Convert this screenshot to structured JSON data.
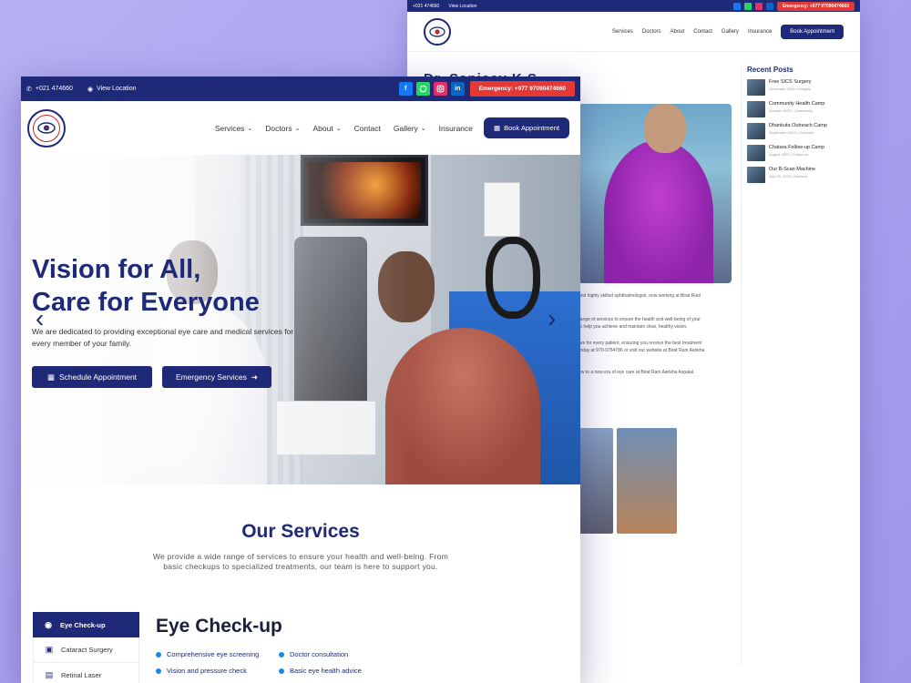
{
  "back": {
    "topbar": {
      "phone": "+021 474660",
      "location": "View Location",
      "emergency": "Emergency: +977 97090474660"
    },
    "nav": [
      "Services",
      "Doctors",
      "About",
      "Contact",
      "Gallery",
      "Insurance"
    ],
    "book": "Book Appointment",
    "title": "Dr. Sanjeev K.S.",
    "paragraphs": [
      "and highly skilled ophthalmologist, now working at Birat Rani",
      "range of services to ensure the health and well-being of your",
      "to help you achieve and maintain clear, healthy vision.",
      "are for every patient, ensuring you receive the best treatment",
      "today at 970-9754786 or visit our website at Birat Rani Aankha",
      "ew to a new era of eye care at Birat Rani Aankha Aspatal."
    ],
    "recent_posts_title": "Recent Posts",
    "posts": [
      {
        "title": "Free SICS Surgery",
        "meta": "December 2023 • Surgery"
      },
      {
        "title": "Community Health Camp",
        "meta": "October 2023 • Community"
      },
      {
        "title": "Dhankuta Outreach Camp",
        "meta": "September 2023 • Outreach"
      },
      {
        "title": "Chatara Follow-up Camp",
        "meta": "August 2023 • Follow-up"
      },
      {
        "title": "Our B-Scan Machine",
        "meta": "July 25, 2023 • Machine"
      }
    ]
  },
  "front": {
    "topbar": {
      "phone": "+021 474660",
      "location": "View Location",
      "socials": [
        "f",
        "w",
        "ig",
        "in"
      ],
      "emergency": "Emergency: +977 97090474660"
    },
    "nav": {
      "services": "Services",
      "doctors": "Doctors",
      "about": "About",
      "contact": "Contact",
      "gallery": "Gallery",
      "insurance": "Insurance",
      "book": "Book Appointment"
    },
    "hero": {
      "title_line1": "Vision for All,",
      "title_line2": "Care for Everyone",
      "subtitle": "We are dedicated to providing exceptional eye care and medical services for every member of your family.",
      "btn_schedule": "Schedule Appointment",
      "btn_emergency": "Emergency Services"
    },
    "services": {
      "heading": "Our Services",
      "description": "We provide a wide range of services to ensure your health and well-being. From basic checkups to specialized treatments, our team is here to support you.",
      "tabs": [
        "Eye Check-up",
        "Cataract Surgery",
        "Retinal Laser"
      ],
      "active_title": "Eye Check-up",
      "items": [
        "Comprehensive eye screening",
        "Doctor consultation",
        "Vision and pressure check",
        "Basic eye health advice"
      ]
    }
  },
  "colors": {
    "navy": "#1e2a78",
    "emergency_red": "#e53935",
    "accent_blue": "#1e88e5"
  }
}
